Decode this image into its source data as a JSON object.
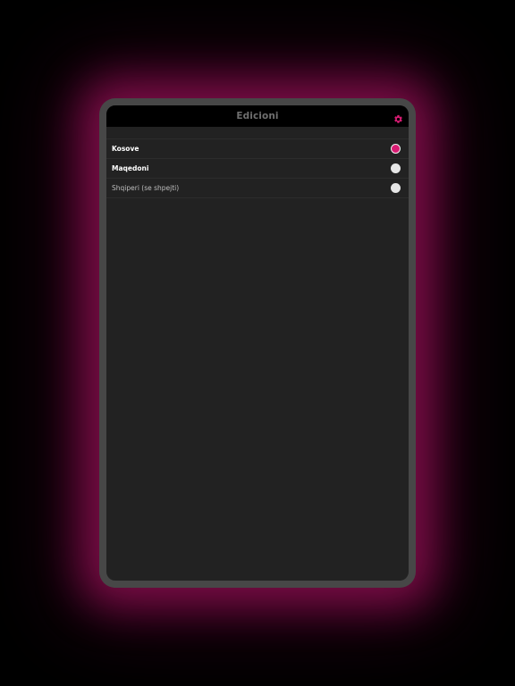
{
  "header": {
    "title": "Edicioni",
    "settings_icon": "gear-icon"
  },
  "editions": [
    {
      "label": "Kosove",
      "selected": true,
      "style": "primary"
    },
    {
      "label": "Maqedoni",
      "selected": false,
      "style": "primary"
    },
    {
      "label": "Shqiperi (se shpejti)",
      "selected": false,
      "style": "muted"
    }
  ],
  "colors": {
    "accent": "#d81b72",
    "background": "#222222",
    "navbar": "#000000",
    "frame": "#474747",
    "glow": "#be146e"
  }
}
